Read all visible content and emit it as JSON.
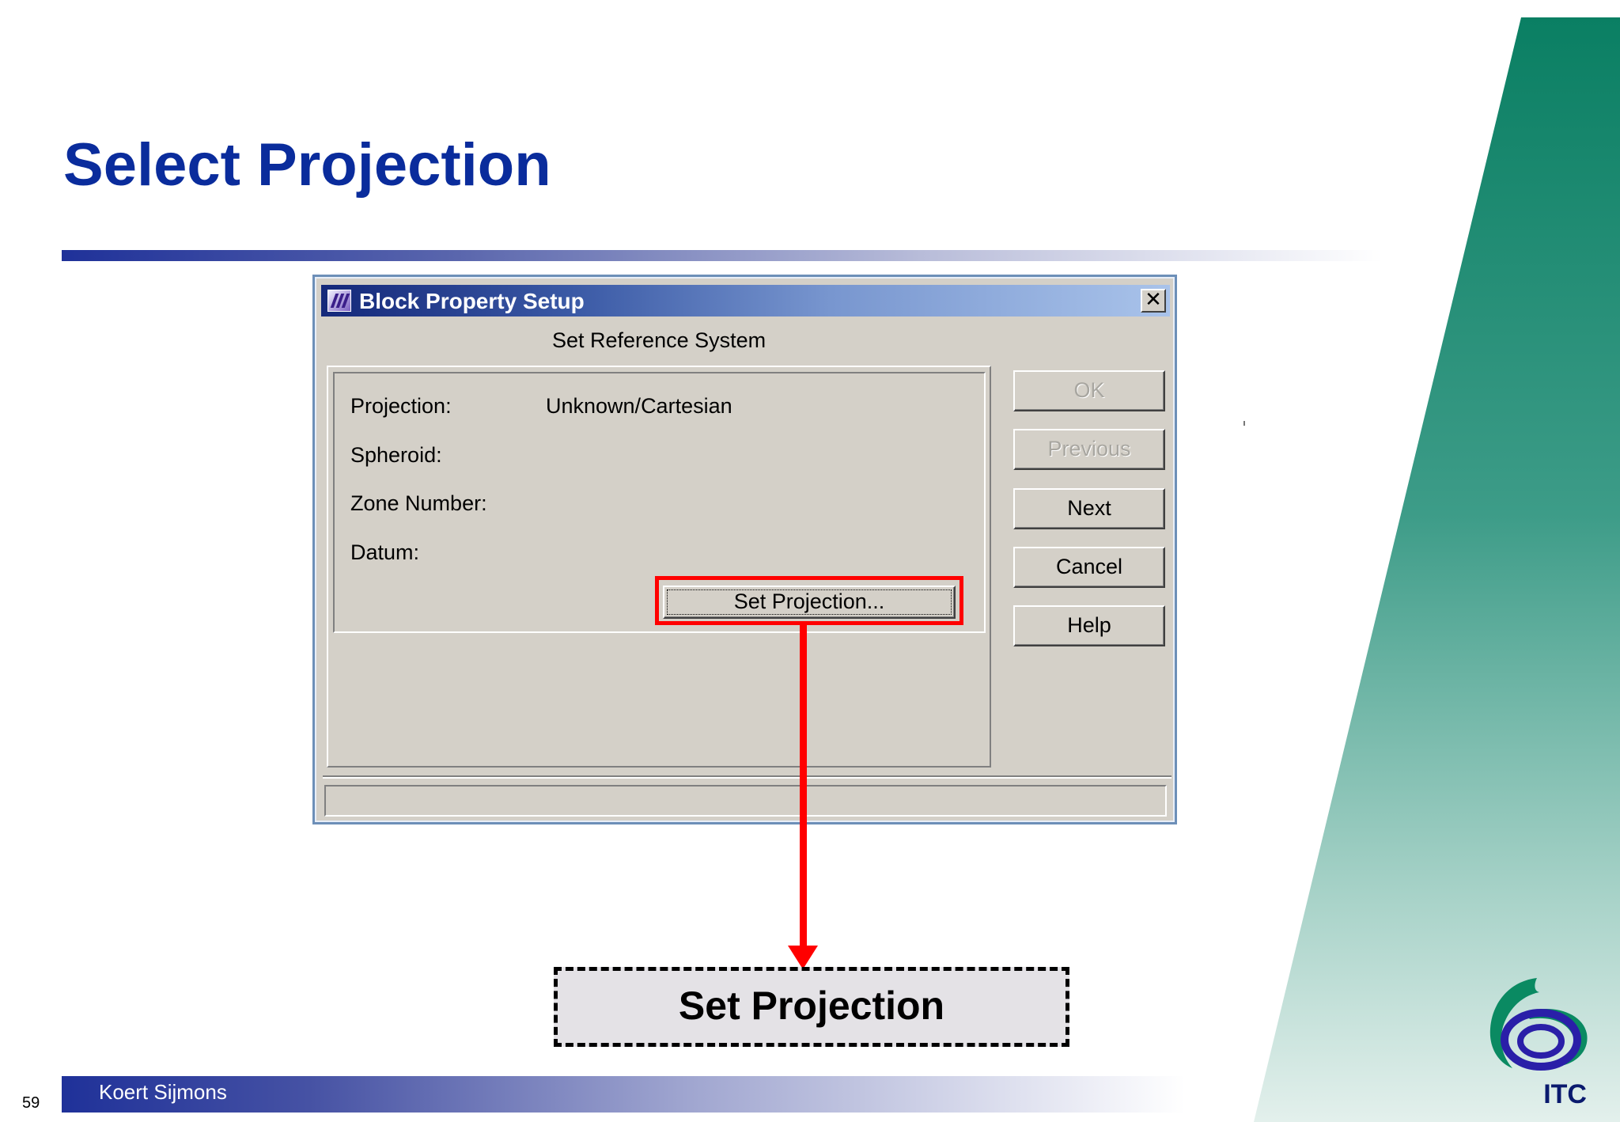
{
  "slide": {
    "title": "Select Projection",
    "author": "Koert Sijmons",
    "page_number": "59",
    "logo_text": "ITC",
    "colors": {
      "title": "#0a2c9c",
      "band_green": "#0a7f63",
      "highlight": "#ff0000"
    }
  },
  "dialog": {
    "title": "Block Property Setup",
    "subtitle": "Set Reference System",
    "fields": [
      {
        "label": "Projection:",
        "value": "Unknown/Cartesian"
      },
      {
        "label": "Spheroid:",
        "value": ""
      },
      {
        "label": "Zone Number:",
        "value": ""
      },
      {
        "label": "Datum:",
        "value": ""
      }
    ],
    "set_projection_label": "Set Projection...",
    "buttons": {
      "ok": "OK",
      "previous": "Previous",
      "next": "Next",
      "cancel": "Cancel",
      "help": "Help"
    },
    "icons": {
      "app": "app-icon",
      "close": "close-icon"
    }
  },
  "callout": {
    "label": "Set Projection"
  }
}
